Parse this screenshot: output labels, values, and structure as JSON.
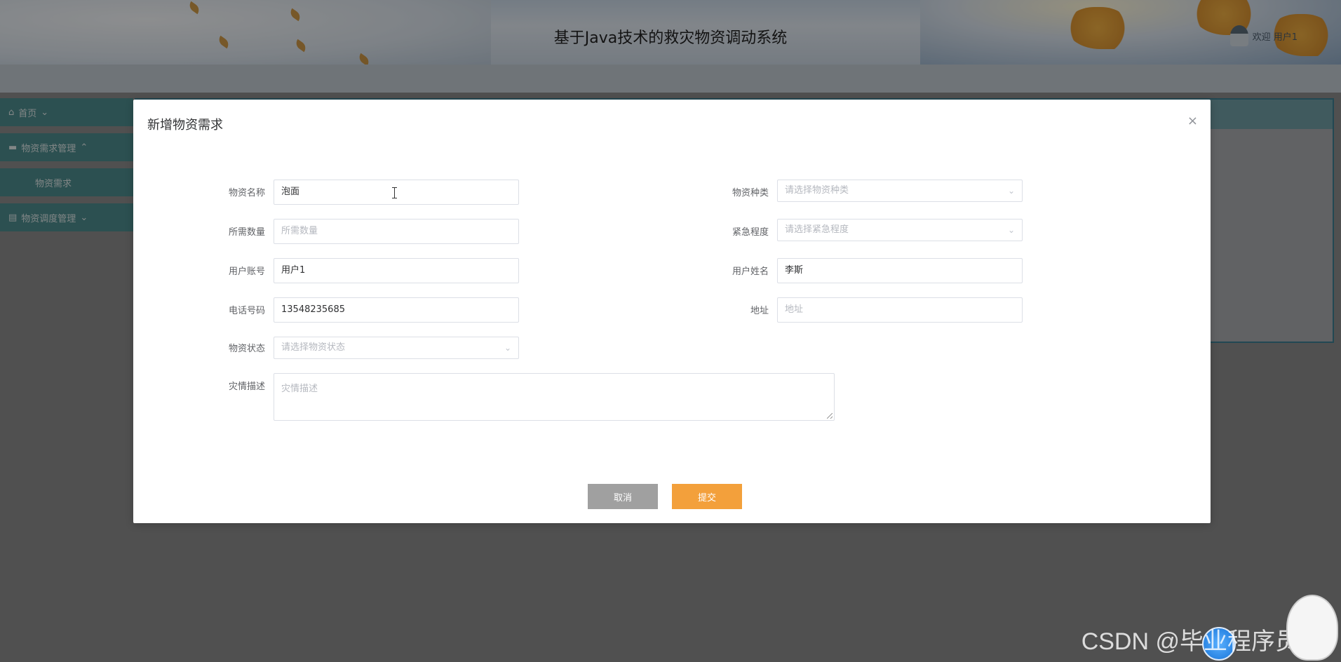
{
  "header": {
    "title": "基于Java技术的救灾物资调动系统",
    "welcome": "欢迎 用户1"
  },
  "sidebar": {
    "items": [
      {
        "label": "首页",
        "icon": "home-icon"
      },
      {
        "label": "物资需求管理",
        "icon": "briefcase-icon"
      },
      {
        "label": "物资需求",
        "icon": ""
      },
      {
        "label": "物资调度管理",
        "icon": "document-icon"
      }
    ]
  },
  "modal": {
    "title": "新增物资需求",
    "close_glyph": "×",
    "fields": {
      "name": {
        "label": "物资名称",
        "value": "泡面"
      },
      "category": {
        "label": "物资种类",
        "placeholder": "请选择物资种类"
      },
      "quantity": {
        "label": "所需数量",
        "placeholder": "所需数量"
      },
      "urgency": {
        "label": "紧急程度",
        "placeholder": "请选择紧急程度"
      },
      "account": {
        "label": "用户账号",
        "value": "用户1"
      },
      "username": {
        "label": "用户姓名",
        "value": "李斯"
      },
      "phone": {
        "label": "电话号码",
        "value": "13548235685"
      },
      "address": {
        "label": "地址",
        "placeholder": "地址"
      },
      "status": {
        "label": "物资状态",
        "placeholder": "请选择物资状态"
      },
      "description": {
        "label": "灾情描述",
        "placeholder": "灾情描述"
      }
    },
    "buttons": {
      "cancel": "取消",
      "submit": "提交"
    }
  },
  "watermark": "CSDN @毕业程序员",
  "colors": {
    "sidebar": "#4d8a8c",
    "submit": "#f3a03b",
    "cancel": "#a0a0a0"
  }
}
